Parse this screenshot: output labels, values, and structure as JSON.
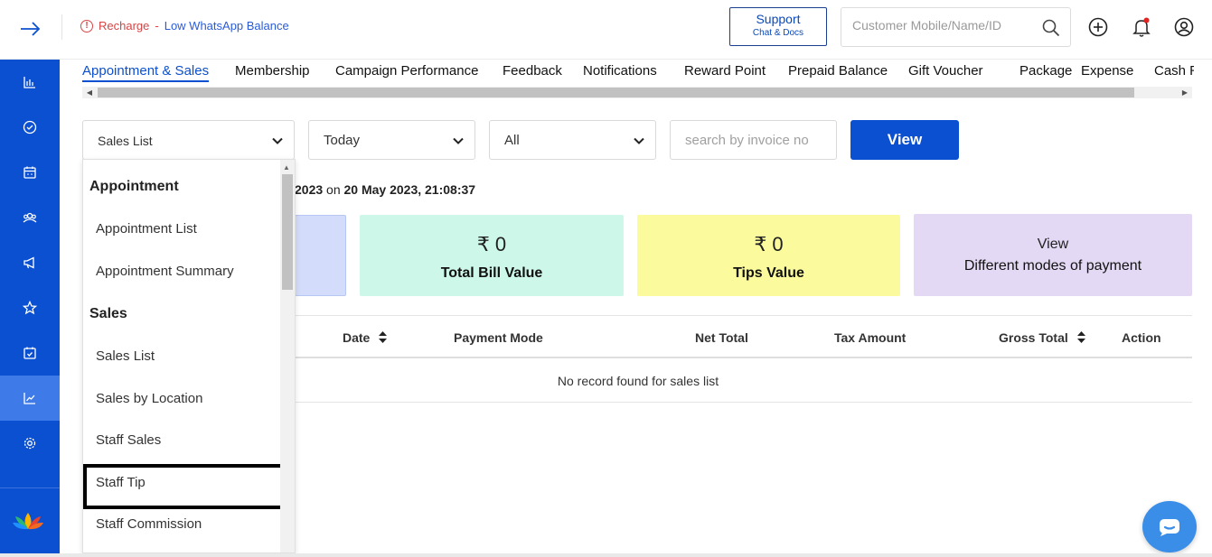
{
  "topbar": {
    "alert_recharge": "Recharge",
    "alert_separator": "-",
    "alert_message": "Low WhatsApp Balance",
    "support_label": "Support",
    "support_sublabel": "Chat & Docs",
    "search_placeholder": "Customer Mobile/Name/ID"
  },
  "tabs": [
    {
      "label": "Appointment & Sales",
      "active": true
    },
    {
      "label": "Membership"
    },
    {
      "label": "Campaign Performance"
    },
    {
      "label": "Feedback"
    },
    {
      "label": "Notifications"
    },
    {
      "label": "Reward Point"
    },
    {
      "label": "Prepaid Balance"
    },
    {
      "label": "Gift Voucher"
    },
    {
      "label": "Package"
    },
    {
      "label": "Expense"
    },
    {
      "label": "Cash R"
    }
  ],
  "filters": {
    "report_type": "Sales List",
    "period": "Today",
    "status": "All",
    "invoice_placeholder": "search by invoice no",
    "view_label": "View"
  },
  "report_time": {
    "partial_date": "2023",
    "on": "on",
    "generated_at": "20 May 2023, 21:08:37"
  },
  "cards": {
    "bill_amount": "₹ 0",
    "bill_label": "Total Bill Value",
    "tips_amount": "₹ 0",
    "tips_label": "Tips Value",
    "payment_line1": "View",
    "payment_line2": "Different modes of payment"
  },
  "table": {
    "headers": {
      "date": "Date",
      "payment_mode": "Payment Mode",
      "net_total": "Net Total",
      "tax_amount": "Tax Amount",
      "gross_total": "Gross Total",
      "action": "Action"
    },
    "empty_message": "No record found for sales list"
  },
  "dropdown": {
    "group_appointment": "Appointment",
    "appointment_list": "Appointment List",
    "appointment_summary": "Appointment Summary",
    "group_sales": "Sales",
    "sales_list": "Sales List",
    "sales_by_location": "Sales by Location",
    "staff_sales": "Staff Sales",
    "staff_tip": "Staff Tip",
    "staff_commission": "Staff Commission"
  },
  "sidebar_icons": [
    "bar-chart-icon",
    "check-circle-icon",
    "calendar-icon",
    "users-icon",
    "megaphone-icon",
    "star-icon",
    "calendar-check-icon",
    "trend-chart-icon",
    "settings-icon"
  ],
  "colors": {
    "primary": "#0b50d0",
    "sidebar_active": "#3f7be8",
    "alert_red": "#d64545",
    "card_green": "#cdf7e9",
    "card_yellow": "#fbfa9d",
    "card_purple": "#e3d9f4"
  }
}
